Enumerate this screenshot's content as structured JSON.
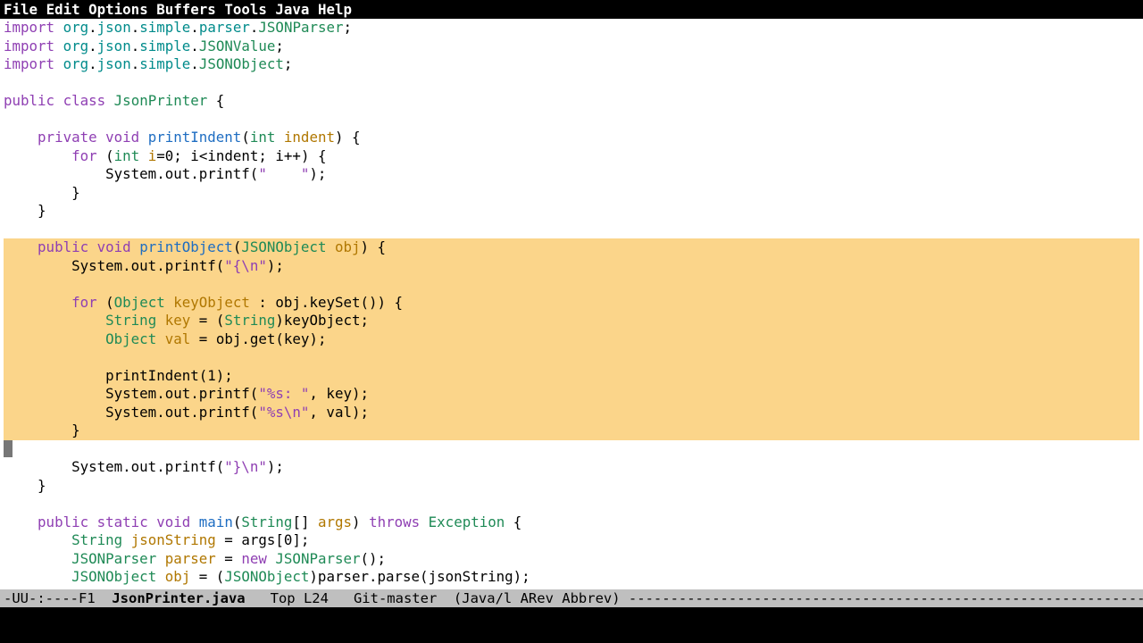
{
  "menubar": {
    "items": [
      "File",
      "Edit",
      "Options",
      "Buffers",
      "Tools",
      "Java",
      "Help"
    ]
  },
  "code": {
    "lines": [
      [
        {
          "c": "kw",
          "t": "import"
        },
        {
          "t": " "
        },
        {
          "c": "lit",
          "t": "org"
        },
        {
          "t": "."
        },
        {
          "c": "lit",
          "t": "json"
        },
        {
          "t": "."
        },
        {
          "c": "lit",
          "t": "simple"
        },
        {
          "t": "."
        },
        {
          "c": "lit",
          "t": "parser"
        },
        {
          "t": "."
        },
        {
          "c": "type",
          "t": "JSONParser"
        },
        {
          "t": ";"
        }
      ],
      [
        {
          "c": "kw",
          "t": "import"
        },
        {
          "t": " "
        },
        {
          "c": "lit",
          "t": "org"
        },
        {
          "t": "."
        },
        {
          "c": "lit",
          "t": "json"
        },
        {
          "t": "."
        },
        {
          "c": "lit",
          "t": "simple"
        },
        {
          "t": "."
        },
        {
          "c": "type",
          "t": "JSONValue"
        },
        {
          "t": ";"
        }
      ],
      [
        {
          "c": "kw",
          "t": "import"
        },
        {
          "t": " "
        },
        {
          "c": "lit",
          "t": "org"
        },
        {
          "t": "."
        },
        {
          "c": "lit",
          "t": "json"
        },
        {
          "t": "."
        },
        {
          "c": "lit",
          "t": "simple"
        },
        {
          "t": "."
        },
        {
          "c": "type",
          "t": "JSONObject"
        },
        {
          "t": ";"
        }
      ],
      [
        {
          "t": ""
        }
      ],
      [
        {
          "c": "kw",
          "t": "public"
        },
        {
          "t": " "
        },
        {
          "c": "kw",
          "t": "class"
        },
        {
          "t": " "
        },
        {
          "c": "type",
          "t": "JsonPrinter"
        },
        {
          "t": " {"
        }
      ],
      [
        {
          "t": ""
        }
      ],
      [
        {
          "t": "    "
        },
        {
          "c": "kw",
          "t": "private"
        },
        {
          "t": " "
        },
        {
          "c": "kw",
          "t": "void"
        },
        {
          "t": " "
        },
        {
          "c": "func",
          "t": "printIndent"
        },
        {
          "t": "("
        },
        {
          "c": "type",
          "t": "int"
        },
        {
          "t": " "
        },
        {
          "c": "var",
          "t": "indent"
        },
        {
          "t": ") {"
        }
      ],
      [
        {
          "t": "        "
        },
        {
          "c": "kw",
          "t": "for"
        },
        {
          "t": " ("
        },
        {
          "c": "type",
          "t": "int"
        },
        {
          "t": " "
        },
        {
          "c": "var",
          "t": "i"
        },
        {
          "t": "="
        },
        {
          "c": "num",
          "t": "0"
        },
        {
          "t": "; i<indent; i++) {"
        }
      ],
      [
        {
          "t": "            System.out.printf("
        },
        {
          "c": "str",
          "t": "\"    \""
        },
        {
          "t": ");"
        }
      ],
      [
        {
          "t": "        }"
        }
      ],
      [
        {
          "t": "    }"
        }
      ],
      [
        {
          "t": ""
        }
      ],
      [
        {
          "t": "    "
        },
        {
          "c": "kw",
          "t": "public"
        },
        {
          "t": " "
        },
        {
          "c": "kw",
          "t": "void"
        },
        {
          "t": " "
        },
        {
          "c": "func",
          "t": "printObject"
        },
        {
          "t": "("
        },
        {
          "c": "type",
          "t": "JSONObject"
        },
        {
          "t": " "
        },
        {
          "c": "var",
          "t": "obj"
        },
        {
          "t": ") {"
        }
      ],
      [
        {
          "t": "        System.out.printf("
        },
        {
          "c": "str",
          "t": "\"{\\n\""
        },
        {
          "t": ");"
        }
      ],
      [
        {
          "t": ""
        }
      ],
      [
        {
          "t": "        "
        },
        {
          "c": "kw",
          "t": "for"
        },
        {
          "t": " ("
        },
        {
          "c": "type",
          "t": "Object"
        },
        {
          "t": " "
        },
        {
          "c": "var",
          "t": "keyObject"
        },
        {
          "t": " : obj.keySet()) {"
        }
      ],
      [
        {
          "t": "            "
        },
        {
          "c": "type",
          "t": "String"
        },
        {
          "t": " "
        },
        {
          "c": "var",
          "t": "key"
        },
        {
          "t": " = ("
        },
        {
          "c": "type",
          "t": "String"
        },
        {
          "t": ")keyObject;"
        }
      ],
      [
        {
          "t": "            "
        },
        {
          "c": "type",
          "t": "Object"
        },
        {
          "t": " "
        },
        {
          "c": "var",
          "t": "val"
        },
        {
          "t": " = obj.get(key);"
        }
      ],
      [
        {
          "t": ""
        }
      ],
      [
        {
          "t": "            printIndent(1);"
        }
      ],
      [
        {
          "t": "            System.out.printf("
        },
        {
          "c": "str",
          "t": "\"%s: \""
        },
        {
          "t": ", key);"
        }
      ],
      [
        {
          "t": "            System.out.printf("
        },
        {
          "c": "str",
          "t": "\"%s\\n\""
        },
        {
          "t": ", val);"
        }
      ],
      [
        {
          "t": "        }"
        }
      ],
      [
        {
          "c": "cursorblock",
          "t": " "
        }
      ],
      [
        {
          "t": "        System.out.printf("
        },
        {
          "c": "str",
          "t": "\"}\\n\""
        },
        {
          "t": ");"
        }
      ],
      [
        {
          "t": "    }"
        }
      ],
      [
        {
          "t": ""
        }
      ],
      [
        {
          "t": "    "
        },
        {
          "c": "kw",
          "t": "public"
        },
        {
          "t": " "
        },
        {
          "c": "kw",
          "t": "static"
        },
        {
          "t": " "
        },
        {
          "c": "kw",
          "t": "void"
        },
        {
          "t": " "
        },
        {
          "c": "func",
          "t": "main"
        },
        {
          "t": "("
        },
        {
          "c": "type",
          "t": "String"
        },
        {
          "t": "[] "
        },
        {
          "c": "var",
          "t": "args"
        },
        {
          "t": ") "
        },
        {
          "c": "kw",
          "t": "throws"
        },
        {
          "t": " "
        },
        {
          "c": "type",
          "t": "Exception"
        },
        {
          "t": " {"
        }
      ],
      [
        {
          "t": "        "
        },
        {
          "c": "type",
          "t": "String"
        },
        {
          "t": " "
        },
        {
          "c": "var",
          "t": "jsonString"
        },
        {
          "t": " = args[0];"
        }
      ],
      [
        {
          "t": "        "
        },
        {
          "c": "type",
          "t": "JSONParser"
        },
        {
          "t": " "
        },
        {
          "c": "var",
          "t": "parser"
        },
        {
          "t": " = "
        },
        {
          "c": "kw",
          "t": "new"
        },
        {
          "t": " "
        },
        {
          "c": "type",
          "t": "JSONParser"
        },
        {
          "t": "();"
        }
      ],
      [
        {
          "t": "        "
        },
        {
          "c": "type",
          "t": "JSONObject"
        },
        {
          "t": " "
        },
        {
          "c": "var",
          "t": "obj"
        },
        {
          "t": " = ("
        },
        {
          "c": "type",
          "t": "JSONObject"
        },
        {
          "t": ")parser.parse(jsonString);"
        }
      ]
    ],
    "highlight_start": 12,
    "highlight_end": 22
  },
  "modeline": {
    "left": "-UU-:----F1  ",
    "buffer_name": "JsonPrinter.java",
    "mid": "   Top L24   Git-master  (Java/l ARev Abbrev) ",
    "dash_count": 70
  }
}
